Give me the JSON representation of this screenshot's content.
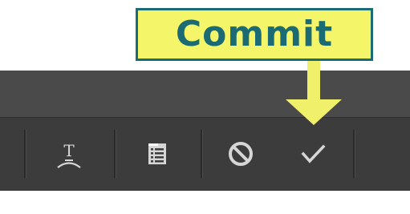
{
  "callout": {
    "label": "Commit",
    "background_color": "#f5f56a",
    "border_color": "#1a6b74",
    "text_color": "#1a6b74"
  },
  "arrow": {
    "color": "#f0f06a",
    "target": "commit-button"
  },
  "toolbar": {
    "buttons": [
      {
        "name": "warp-text",
        "icon": "warp-text-icon"
      },
      {
        "name": "character-paragraph-panels",
        "icon": "panels-icon"
      },
      {
        "name": "cancel",
        "icon": "cancel-icon"
      },
      {
        "name": "commit",
        "icon": "checkmark-icon"
      }
    ]
  },
  "colors": {
    "app_bar": "#4a4a4a",
    "options_bar": "#3c3c3c",
    "icon": "#d6d6d6"
  }
}
